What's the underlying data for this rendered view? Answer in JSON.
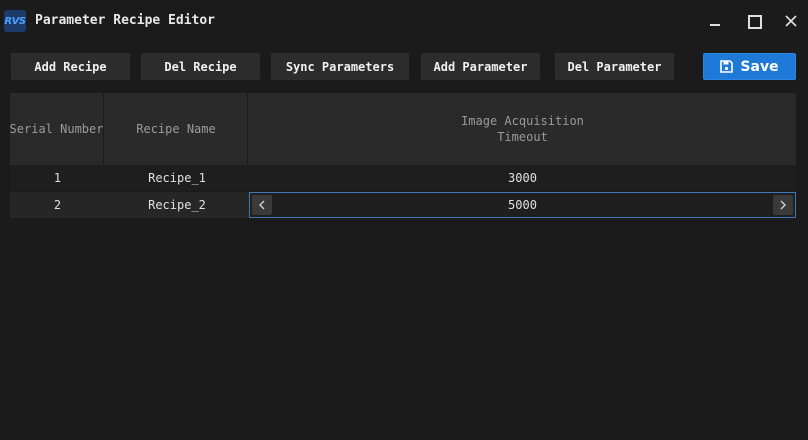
{
  "window": {
    "logo_text": "RVS",
    "title": "Parameter Recipe Editor"
  },
  "toolbar": {
    "add_recipe": "Add Recipe",
    "del_recipe": "Del Recipe",
    "sync_parameters": "Sync Parameters",
    "add_parameter": "Add Parameter",
    "del_parameter": "Del Parameter",
    "save": "Save"
  },
  "table": {
    "columns": [
      "Serial Number",
      "Recipe Name",
      "Image Acquisition\nTimeout"
    ],
    "rows": [
      {
        "serial": "1",
        "name": "Recipe_1",
        "timeout": "3000"
      },
      {
        "serial": "2",
        "name": "Recipe_2",
        "timeout": "5000"
      }
    ]
  },
  "icons": {
    "logo": "app-logo-icon",
    "minimize": "minimize-icon",
    "maximize": "maximize-icon",
    "close": "close-icon",
    "save": "floppy-disk-icon",
    "decrement": "chevron-left-icon",
    "increment": "chevron-right-icon"
  },
  "colors": {
    "background": "#1b1b1b",
    "accent": "#1e7ad6",
    "header": "#2a2a2a",
    "editor_border": "#3e78b8"
  }
}
